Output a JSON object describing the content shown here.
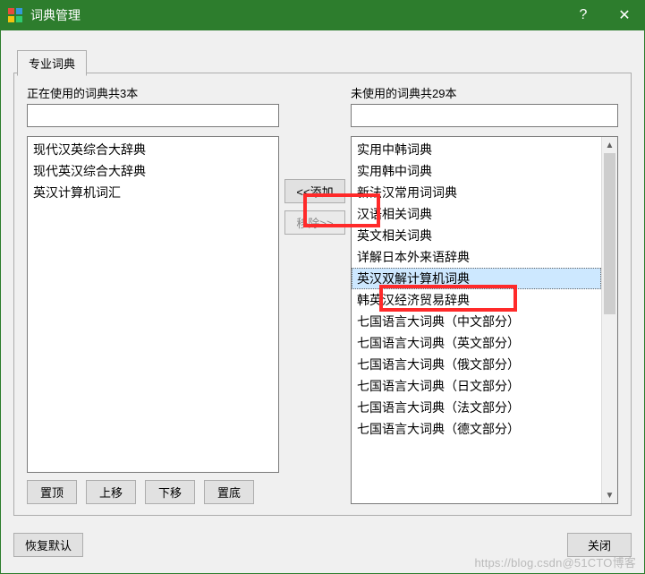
{
  "window": {
    "title": "词典管理",
    "help_icon": "?",
    "close_icon": "✕"
  },
  "tabs": {
    "professional": "专业词典"
  },
  "left": {
    "label": "正在使用的词典共3本",
    "search_placeholder": "",
    "items": [
      "现代汉英综合大辞典",
      "现代英汉综合大辞典",
      "英汉计算机词汇"
    ]
  },
  "mid": {
    "add": "<<添加",
    "remove": "移除>>"
  },
  "right": {
    "label": "未使用的词典共29本",
    "search_placeholder": "",
    "selected_index": 6,
    "items": [
      "实用中韩词典",
      "实用韩中词典",
      "新法汉常用词词典",
      "汉语相关词典",
      "英文相关词典",
      "详解日本外来语辞典",
      "英汉双解计算机词典",
      "韩英汉经济贸易辞典",
      "七国语言大词典（中文部分）",
      "七国语言大词典（英文部分）",
      "七国语言大词典（俄文部分）",
      "七国语言大词典（日文部分）",
      "七国语言大词典（法文部分）",
      "七国语言大词典（德文部分）"
    ]
  },
  "order_buttons": {
    "top": "置顶",
    "up": "上移",
    "down": "下移",
    "bottom": "置底"
  },
  "footer": {
    "restore": "恢复默认",
    "close": "关闭"
  },
  "watermark": "https://blog.csdn@51CTO博客"
}
